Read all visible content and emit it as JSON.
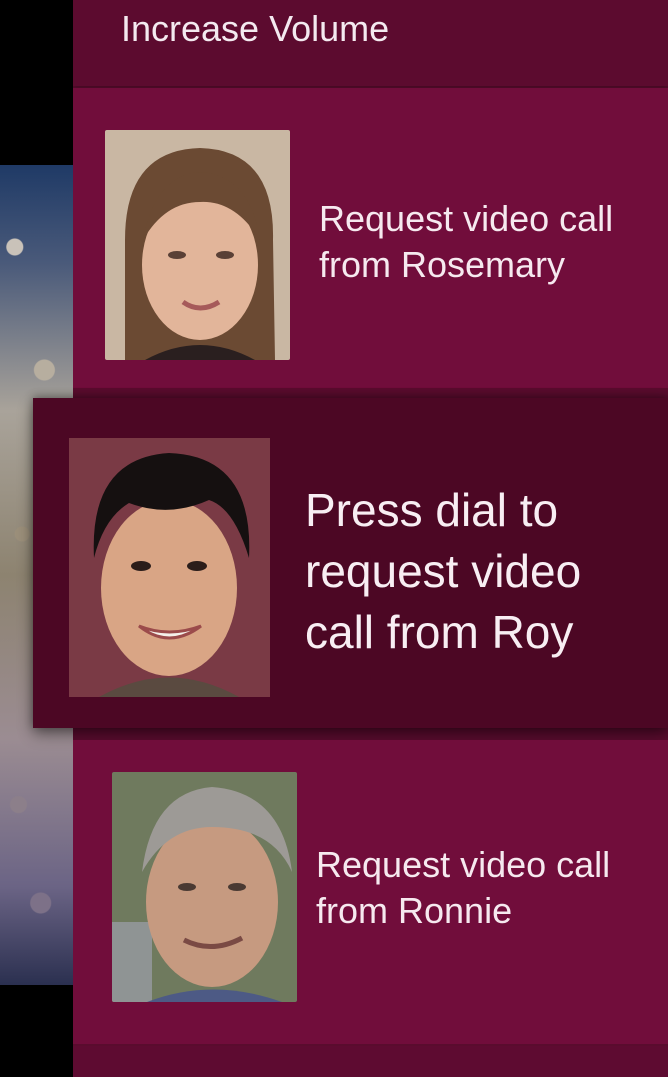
{
  "menu": {
    "volume_label": "Increase Volume",
    "contacts": [
      {
        "name": "Rosemary",
        "label": "Request video call from Rosemary",
        "avatar_icon": "person-photo-icon"
      },
      {
        "name": "Roy",
        "label": "Press dial to request video call from Roy",
        "avatar_icon": "person-photo-icon",
        "focused": true
      },
      {
        "name": "Ronnie",
        "label": "Request video call from Ronnie",
        "avatar_icon": "person-photo-icon"
      }
    ]
  },
  "colors": {
    "panel": "#5a0c2e",
    "row": "#710d3b",
    "focused_row": "#4c0724",
    "text": "#f6e9ef"
  }
}
